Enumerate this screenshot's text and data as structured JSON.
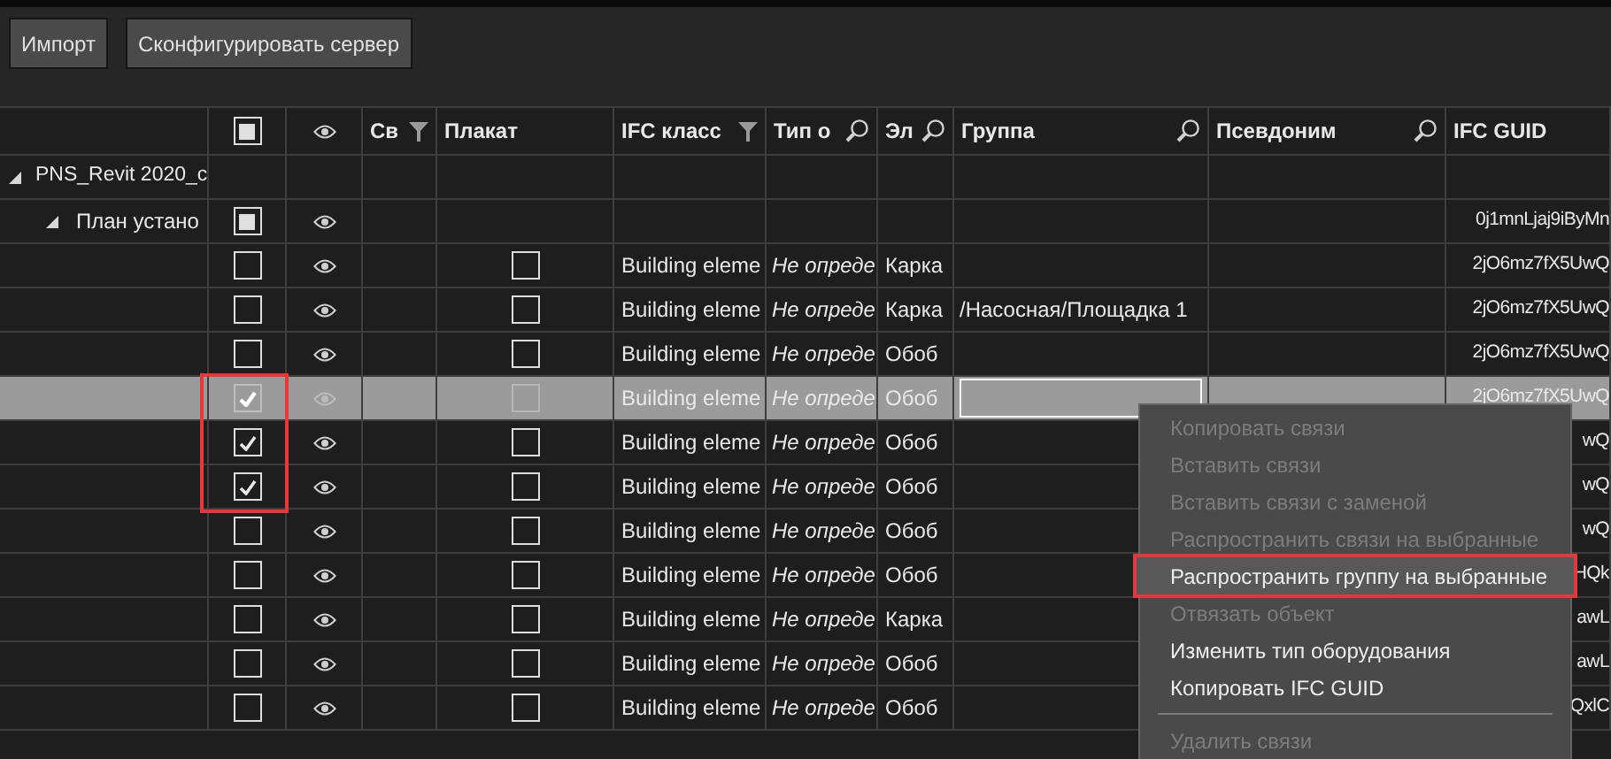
{
  "toolbar": {
    "buttons": [
      "Импорт",
      "Сконфигурировать сервер"
    ]
  },
  "table": {
    "columns": [
      {
        "kind": "tree"
      },
      {
        "kind": "check",
        "mixed": true
      },
      {
        "kind": "eye"
      },
      {
        "kind": "text",
        "label": "Св",
        "filter": true
      },
      {
        "kind": "text",
        "label": "Плакат"
      },
      {
        "kind": "text",
        "label": "IFC класс",
        "filter": true
      },
      {
        "kind": "text",
        "label": "Тип о",
        "search": true
      },
      {
        "kind": "text",
        "label": "Эл",
        "search": true
      },
      {
        "kind": "text",
        "label": "Группа",
        "search": true
      },
      {
        "kind": "text",
        "label": "Псевдоним",
        "search": true
      },
      {
        "kind": "text",
        "label": "IFC GUID"
      }
    ],
    "tree": [
      {
        "label": "PNS_Revit 2020_c",
        "expanded": true,
        "children": [
          {
            "label": "План устано",
            "expanded": true,
            "mixed": true,
            "visible": true,
            "guid": "0j1mnLjaj9iByMn",
            "children": [
              {
                "checked": false,
                "selected": false,
                "marked": false,
                "visible": true,
                "poster": false,
                "ifc_class": "Building eleme",
                "type": "Не опреде",
                "element": "Карка",
                "guid": "2jO6mz7fX5UwQ"
              },
              {
                "checked": false,
                "selected": false,
                "marked": false,
                "visible": true,
                "poster": false,
                "ifc_class": "Building eleme",
                "type": "Не опреде",
                "element": "Карка",
                "group": "/Насосная/Площадка 1",
                "guid": "2jO6mz7fX5UwQ"
              },
              {
                "checked": false,
                "selected": false,
                "marked": false,
                "visible": true,
                "poster": false,
                "ifc_class": "Building eleme",
                "type": "Не опреде",
                "element": "Обоб",
                "guid": "2jO6mz7fX5UwQ"
              },
              {
                "checked": true,
                "selected": true,
                "marked": true,
                "visible": true,
                "poster": false,
                "ifc_class": "Building eleme",
                "type": "Не опреде",
                "element": "Обоб",
                "guid": "2jO6mz7fX5UwQ"
              },
              {
                "checked": true,
                "selected": false,
                "marked": true,
                "visible": true,
                "poster": false,
                "ifc_class": "Building eleme",
                "type": "Не опреде",
                "element": "Обоб",
                "guid": "wQ"
              },
              {
                "checked": true,
                "selected": false,
                "marked": true,
                "visible": true,
                "poster": false,
                "ifc_class": "Building eleme",
                "type": "Не опреде",
                "element": "Обоб",
                "guid": "wQ"
              },
              {
                "checked": false,
                "selected": false,
                "marked": false,
                "visible": true,
                "poster": false,
                "ifc_class": "Building eleme",
                "type": "Не опреде",
                "element": "Обоб",
                "guid": "wQ"
              },
              {
                "checked": false,
                "selected": false,
                "marked": false,
                "visible": true,
                "poster": false,
                "ifc_class": "Building eleme",
                "type": "Не опреде",
                "element": "Обоб",
                "guid": "HQk"
              },
              {
                "checked": false,
                "selected": false,
                "marked": false,
                "visible": true,
                "poster": false,
                "ifc_class": "Building eleme",
                "type": "Не опреде",
                "element": "Карка",
                "guid": "awL"
              },
              {
                "checked": false,
                "selected": false,
                "marked": false,
                "visible": true,
                "poster": false,
                "ifc_class": "Building eleme",
                "type": "Не опреде",
                "element": "Обоб",
                "guid": "awL"
              },
              {
                "checked": false,
                "selected": false,
                "marked": false,
                "visible": true,
                "poster": false,
                "ifc_class": "Building eleme",
                "type": "Не опреде",
                "element": "Обоб",
                "guid": "QxlC"
              }
            ]
          }
        ]
      }
    ]
  },
  "context_menu": {
    "items": [
      {
        "kind": "item",
        "label": "Копировать связи",
        "disabled": true,
        "highlighted": false
      },
      {
        "kind": "item",
        "label": "Вставить связи",
        "disabled": true,
        "highlighted": false
      },
      {
        "kind": "item",
        "label": "Вставить связи с заменой",
        "disabled": true,
        "highlighted": false
      },
      {
        "kind": "item",
        "label": "Распространить связи на выбранные",
        "disabled": true,
        "highlighted": false
      },
      {
        "kind": "item",
        "label": "Распространить группу на выбранные",
        "disabled": false,
        "highlighted": true
      },
      {
        "kind": "item",
        "label": "Отвязать объект",
        "disabled": true,
        "highlighted": false
      },
      {
        "kind": "item",
        "label": "Изменить тип оборудования",
        "disabled": false,
        "highlighted": false
      },
      {
        "kind": "item",
        "label": "Копировать IFC GUID",
        "disabled": false,
        "highlighted": false
      },
      {
        "kind": "separator"
      },
      {
        "kind": "item",
        "label": "Удалить связи",
        "disabled": true,
        "highlighted": false
      }
    ]
  }
}
